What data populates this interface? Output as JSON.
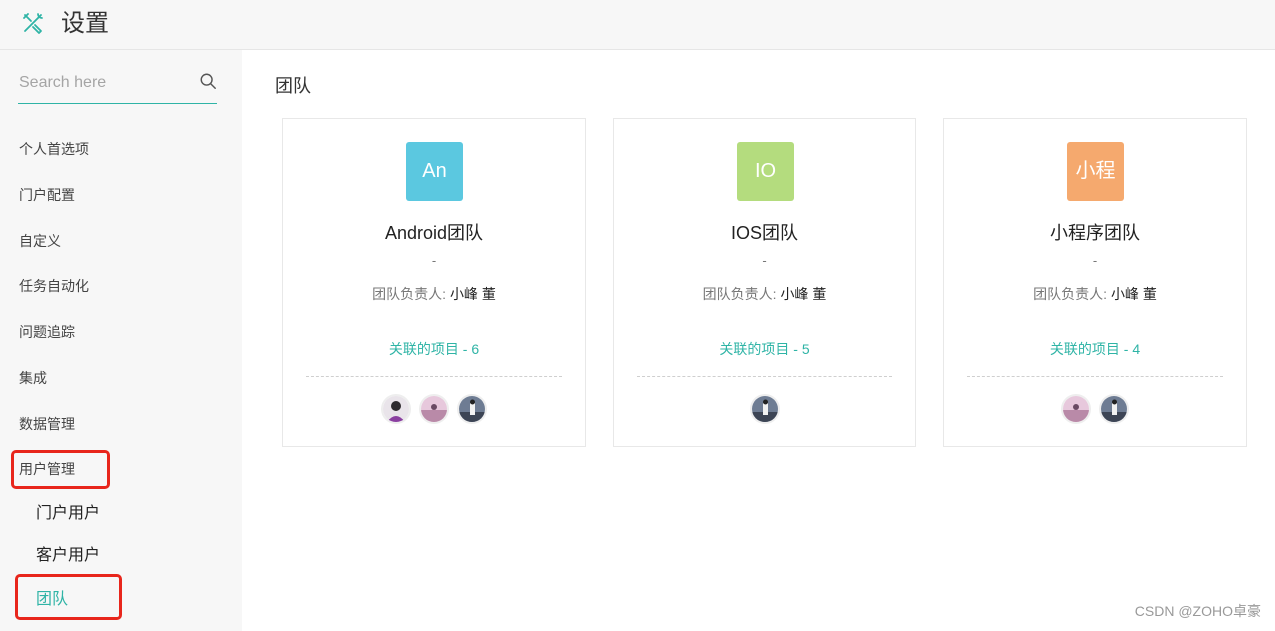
{
  "header": {
    "title": "设置",
    "logo_icon": "tools-icon"
  },
  "sidebar": {
    "search_placeholder": "Search here",
    "items": [
      "个人首选项",
      "门户配置",
      "自定义",
      "任务自动化",
      "问题追踪",
      "集成",
      "数据管理",
      "用户管理"
    ],
    "sub_items": [
      "门户用户",
      "客户用户",
      "团队"
    ],
    "active_sub_item": "团队"
  },
  "main": {
    "title": "团队",
    "teams": [
      {
        "badge": "An",
        "badge_color": "#5bc8e0",
        "name": "Android团队",
        "desc": "-",
        "owner_label": "团队负责人:",
        "owner": "小峰 董",
        "projects": "关联的项目 - 6"
      },
      {
        "badge": "IO",
        "badge_color": "#b4dc7e",
        "name": "IOS团队",
        "desc": "-",
        "owner_label": "团队负责人:",
        "owner": "小峰 董",
        "projects": "关联的项目 - 5"
      },
      {
        "badge": "小程",
        "badge_color": "#f5a96e",
        "name": "小程序团队",
        "desc": "-",
        "owner_label": "团队负责人:",
        "owner": "小峰 董",
        "projects": "关联的项目 - 4"
      }
    ]
  },
  "accent_color": "#2fb4a6",
  "highlight_color": "#e8261c",
  "watermark": "CSDN @ZOHO卓豪"
}
